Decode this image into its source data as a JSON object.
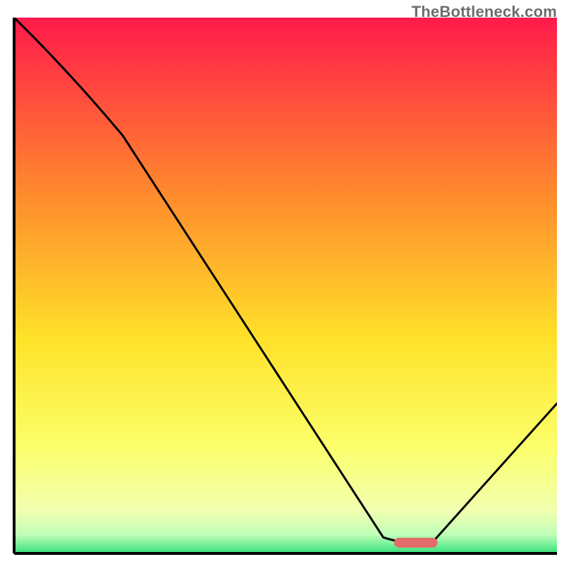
{
  "watermark": "TheBottleneck.com",
  "chart_data": {
    "type": "line",
    "title": "",
    "xlabel": "",
    "ylabel": "",
    "xlim": [
      0,
      100
    ],
    "ylim": [
      0,
      100
    ],
    "x": [
      0,
      20,
      68,
      77,
      100
    ],
    "values": [
      100,
      78,
      3,
      2,
      28
    ],
    "marker": {
      "x_start": 70,
      "x_end": 78,
      "y": 2,
      "color": "#e46b6b"
    },
    "gradient_stops": [
      {
        "offset": 0,
        "color": "#ff1a4b"
      },
      {
        "offset": 0.33,
        "color": "#ff8b2d"
      },
      {
        "offset": 0.6,
        "color": "#ffe229"
      },
      {
        "offset": 0.8,
        "color": "#fbff6a"
      },
      {
        "offset": 0.92,
        "color": "#f1ffb0"
      },
      {
        "offset": 0.965,
        "color": "#c0ffb8"
      },
      {
        "offset": 1.0,
        "color": "#34e07a"
      }
    ],
    "axis_color": "#000000",
    "line_color": "#000000"
  }
}
